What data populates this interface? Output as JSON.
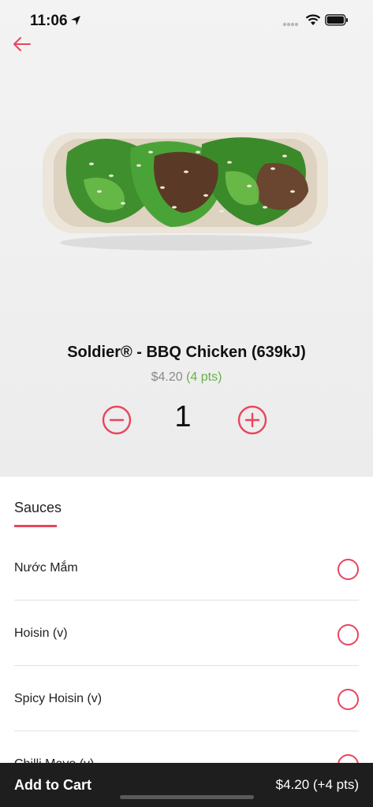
{
  "status_bar": {
    "time": "11:06"
  },
  "product": {
    "name": "Soldier® - BBQ Chicken (639kJ)",
    "price": "$4.20",
    "points": "(4 pts)",
    "quantity": "1"
  },
  "options": {
    "tab_label": "Sauces",
    "items": [
      {
        "label": "Nước Mắm"
      },
      {
        "label": "Hoisin (v)"
      },
      {
        "label": "Spicy Hoisin (v)"
      },
      {
        "label": "Chilli Mayo (v)"
      }
    ]
  },
  "cart": {
    "label": "Add to Cart",
    "total": "$4.20 (+4 pts)"
  },
  "colors": {
    "accent": "#e8455c",
    "points_green": "#6ab04c",
    "bottom_bar": "#1e1e1e"
  }
}
